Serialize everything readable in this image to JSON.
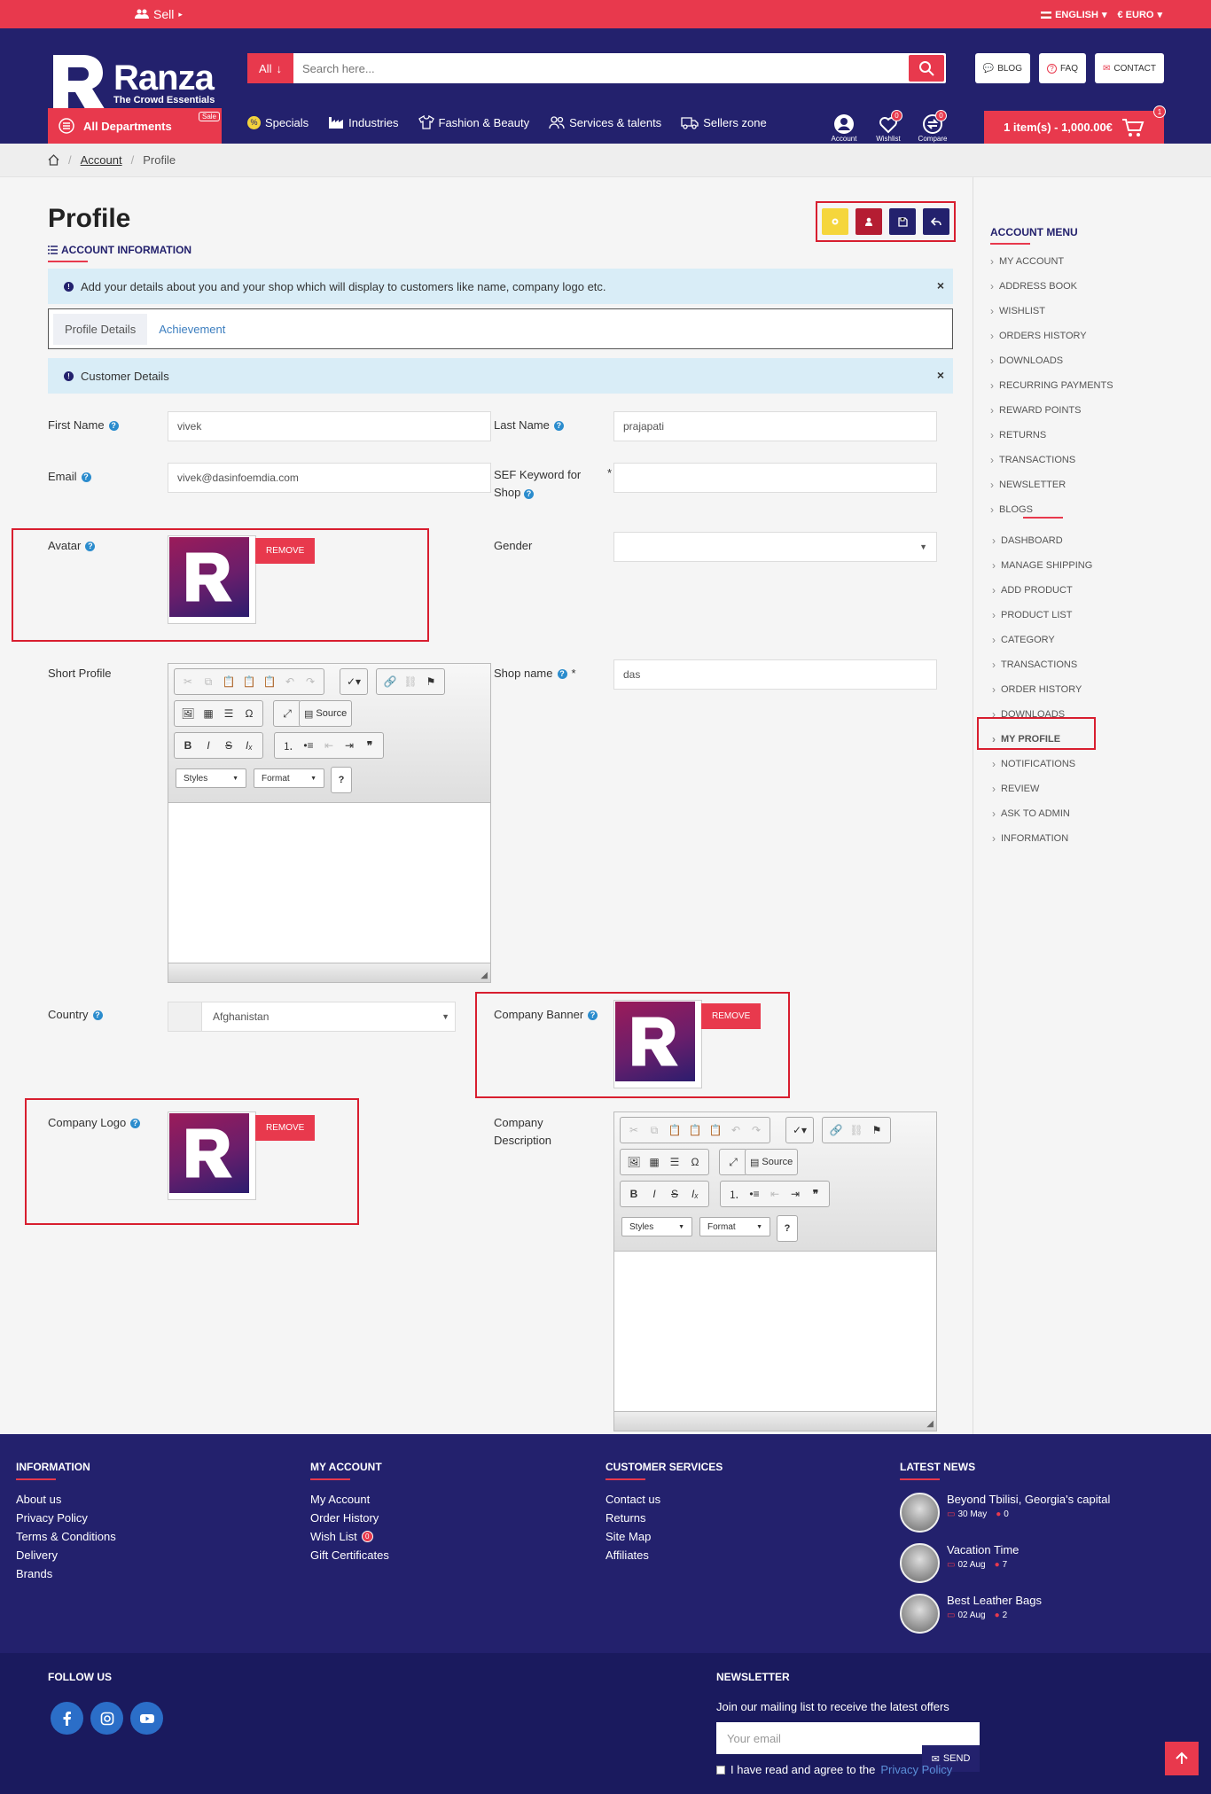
{
  "topbar": {
    "sell": "Sell",
    "language": "ENGLISH",
    "currency": "€ EURO"
  },
  "header": {
    "brand": "Ranza",
    "tagline": "The Crowd Essentials",
    "search_category": "All",
    "search_placeholder": "Search here...",
    "links": [
      "BLOG",
      "FAQ",
      "CONTACT"
    ],
    "all_departments": "All Departments",
    "sale_badge": "Sale",
    "nav": [
      "Specials",
      "Industries",
      "Fashion & Beauty",
      "Services & talents",
      "Sellers zone"
    ],
    "icons": [
      {
        "label": "Account",
        "icon": "account-icon",
        "badge": ""
      },
      {
        "label": "Wishlist",
        "icon": "heart-icon",
        "badge": "0"
      },
      {
        "label": "Compare",
        "icon": "compare-icon",
        "badge": "0"
      }
    ],
    "cart_label": "1 item(s) - 1,000.00€",
    "cart_badge": "1"
  },
  "breadcrumb": {
    "items": [
      "Account",
      "Profile"
    ]
  },
  "page": {
    "title": "Profile",
    "section": "ACCOUNT INFORMATION",
    "info_alert": "Add your details about you and your shop which will display to customers like name, company logo etc.",
    "tabs": [
      "Profile Details",
      "Achievement"
    ],
    "customer_alert": "Customer Details",
    "close_symbol": "×"
  },
  "form": {
    "first_name_label": "First Name",
    "first_name_value": "vivek",
    "last_name_label": "Last Name",
    "last_name_value": "prajapati",
    "email_label": "Email",
    "email_value": "vivek@dasinfoemdia.com",
    "sef_label": "SEF Keyword for Shop",
    "sef_value": "",
    "avatar_label": "Avatar",
    "gender_label": "Gender",
    "gender_value": "",
    "short_profile_label": "Short Profile",
    "shop_name_label": "Shop name",
    "shop_name_value": "das",
    "country_label": "Country",
    "country_value": "Afghanistan",
    "banner_label": "Company Banner",
    "logo_label": "Company Logo",
    "description_label": "Company Description",
    "remove_label": "REMOVE",
    "required_mark": "*",
    "help_mark": "?"
  },
  "editor": {
    "source": "Source",
    "styles": "Styles",
    "format": "Format",
    "help": "?"
  },
  "sidebar": {
    "title": "ACCOUNT MENU",
    "account_items": [
      "MY ACCOUNT",
      "ADDRESS BOOK",
      "WISHLIST",
      "ORDERS HISTORY",
      "DOWNLOADS",
      "RECURRING PAYMENTS",
      "REWARD POINTS",
      "RETURNS",
      "TRANSACTIONS",
      "NEWSLETTER",
      "BLOGS"
    ],
    "seller_items": [
      "DASHBOARD",
      "MANAGE SHIPPING",
      "ADD PRODUCT",
      "PRODUCT LIST",
      "CATEGORY",
      "TRANSACTIONS",
      "ORDER HISTORY",
      "DOWNLOADS",
      "MY PROFILE",
      "NOTIFICATIONS",
      "REVIEW",
      "ASK TO ADMIN",
      "INFORMATION"
    ]
  },
  "footer": {
    "info_title": "INFORMATION",
    "info_links": [
      "About us",
      "Privacy Policy",
      "Terms & Conditions",
      "Delivery",
      "Brands"
    ],
    "account_title": "MY ACCOUNT",
    "account_links": [
      "My Account",
      "Order History",
      "Wish List",
      "Gift Certificates"
    ],
    "wishlist_count": "0",
    "service_title": "CUSTOMER SERVICES",
    "service_links": [
      "Contact us",
      "Returns",
      "Site Map",
      "Affiliates"
    ],
    "news_title": "LATEST NEWS",
    "news": [
      {
        "title": "Beyond Tbilisi, Georgia's capital",
        "date": "30 May",
        "comments": "0"
      },
      {
        "title": "Vacation Time",
        "date": "02 Aug",
        "comments": "7"
      },
      {
        "title": "Best Leather Bags",
        "date": "02 Aug",
        "comments": "2"
      }
    ],
    "follow_title": "FOLLOW US",
    "newsletter_title": "NEWSLETTER",
    "newsletter_text": "Join our mailing list to receive the latest offers",
    "email_placeholder": "Your email",
    "send_label": "SEND",
    "agree_text": "I have read and agree to the",
    "privacy_link": "Privacy Policy"
  },
  "colors": {
    "brand_red": "#e8394d",
    "brand_navy": "#23216d",
    "highlight": "#d81e2f"
  }
}
